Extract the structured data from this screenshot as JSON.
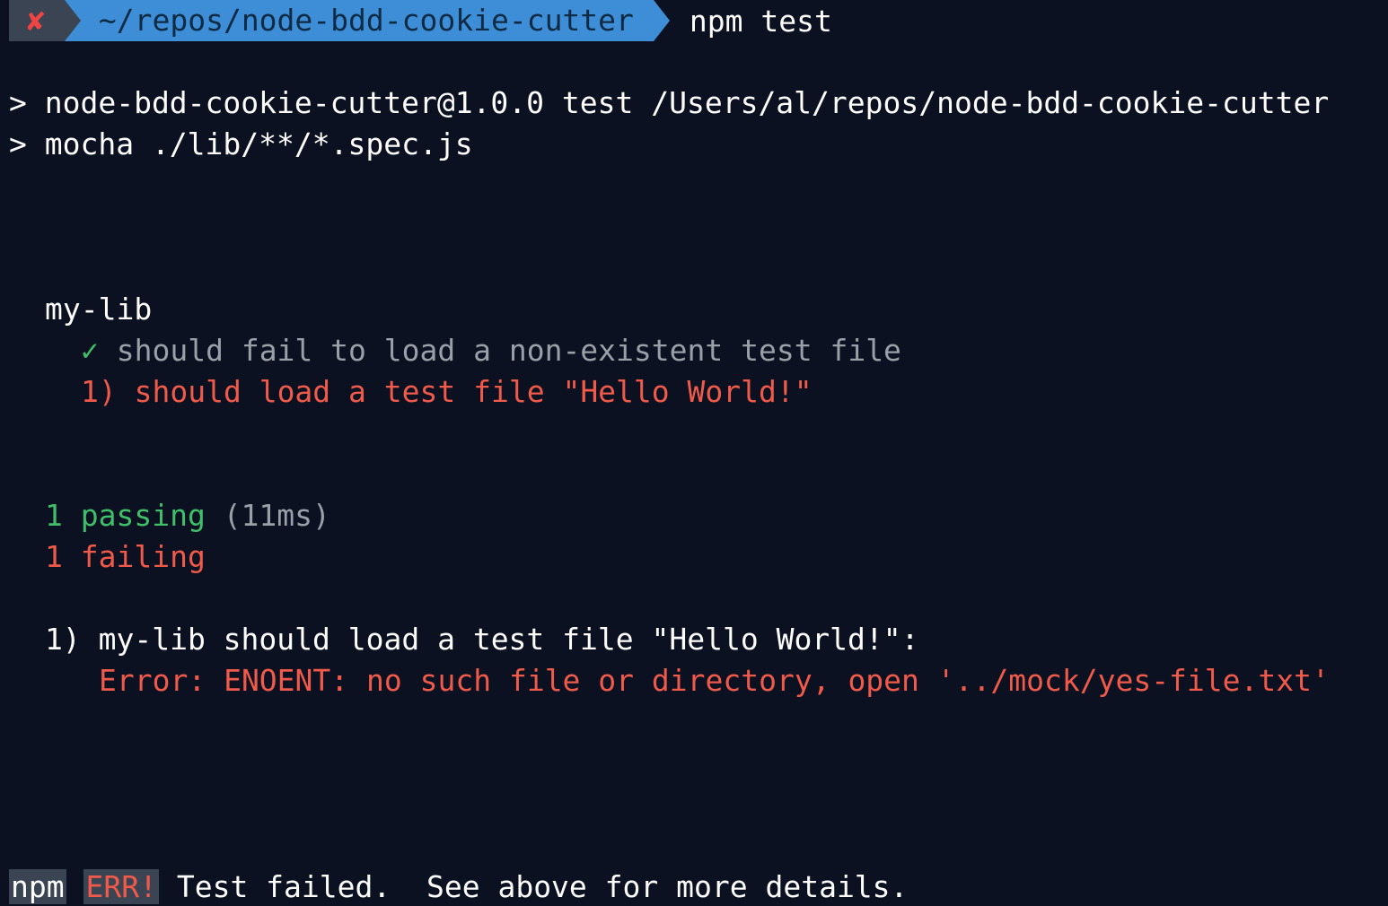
{
  "prompt": {
    "status_icon": "✘",
    "path": "~/repos/node-bdd-cookie-cutter",
    "command": "npm test"
  },
  "output": {
    "script_line_1": "> node-bdd-cookie-cutter@1.0.0 test /Users/al/repos/node-bdd-cookie-cutter",
    "script_line_2": "> mocha ./lib/**/*.spec.js",
    "suite_name": "my-lib",
    "pass_mark": "✓",
    "pass_test": "should fail to load a non-existent test file",
    "fail_index": "1)",
    "fail_test": "should load a test file \"Hello World!\"",
    "passing_count": "1 passing",
    "passing_time": "(11ms)",
    "failing_count": "1 failing",
    "failure_header": "1) my-lib should load a test file \"Hello World!\":",
    "failure_error": "Error: ENOENT: no such file or directory, open '../mock/yes-file.txt'"
  },
  "footer": {
    "npm_tag": "npm",
    "err_tag": "ERR!",
    "message": " Test failed.  See above for more details."
  },
  "colors": {
    "background": "#0b1120",
    "path_segment": "#3d8ed6",
    "status_segment": "#3a4452",
    "pass": "#3fbf6a",
    "fail": "#ef5a4a",
    "muted": "#9aa0a8"
  }
}
